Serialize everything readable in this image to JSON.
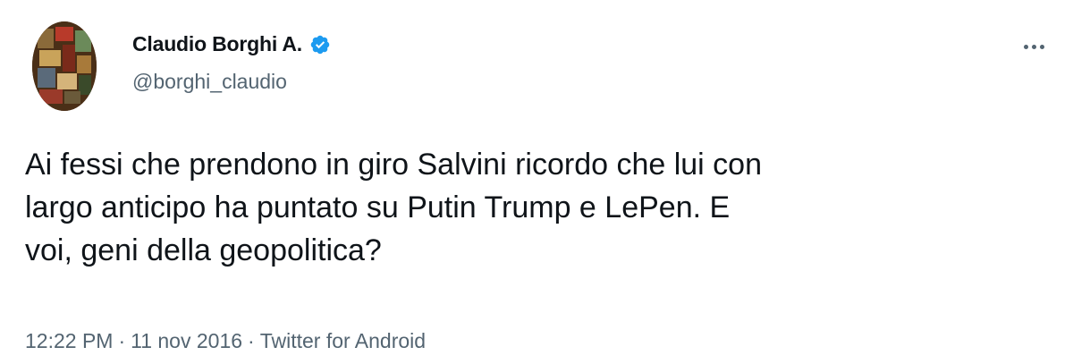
{
  "author": {
    "display_name": "Claudio Borghi A.",
    "handle": "@borghi_claudio",
    "verified": true,
    "avatar_icon": "avatar-image"
  },
  "tweet": {
    "text": "Ai fessi che prendono in giro Salvini ricordo che lui con\nlargo anticipo ha puntato su Putin Trump e LePen. E\nvoi,  geni della geopolitica?",
    "time": "12:22 PM",
    "separator": "·",
    "date": "11 nov 2016",
    "source": "Twitter for Android"
  },
  "actions": {
    "more_icon": "more-icon"
  },
  "colors": {
    "text": "#0f1419",
    "secondary": "#536471",
    "verified": "#1d9bf0"
  }
}
